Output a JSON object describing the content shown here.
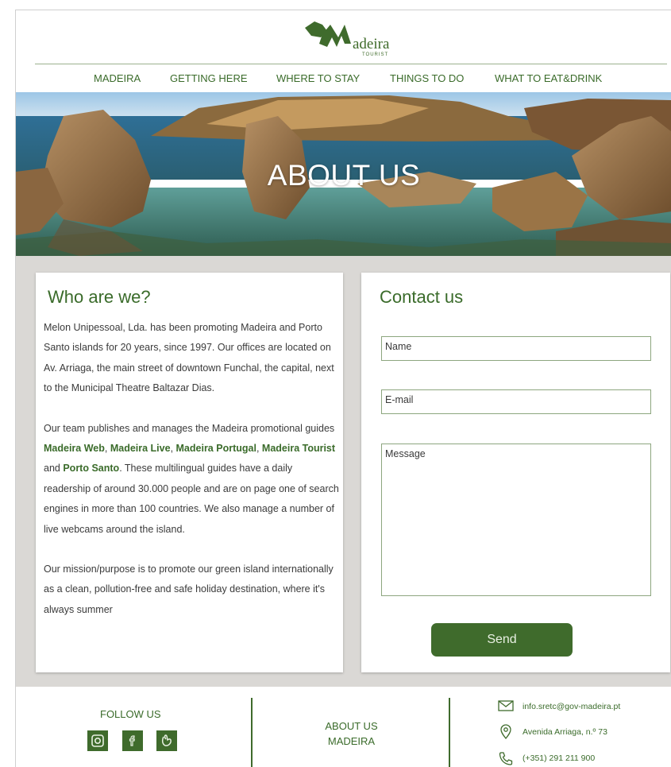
{
  "brand": {
    "name": "adeira",
    "tagline": "TOURIST",
    "green": "#3f6b2c"
  },
  "nav": {
    "items": [
      "MADEIRA",
      "GETTING HERE",
      "WHERE TO STAY",
      "THINGS TO DO",
      "WHAT TO EAT&DRINK"
    ]
  },
  "hero": {
    "title": "ABOUT US"
  },
  "about": {
    "heading": "Who are we?",
    "p1": "Melon Unipessoal, Lda. has been promoting Madeira and Porto Santo islands for 20 years, since 1997. Our offices are located on Av. Arriaga, the main street of downtown Funchal, the capital, next to the Municipal Theatre Baltazar Dias.",
    "p2_a": "Our team publishes and manages the Madeira promotional guides ",
    "guides": [
      "Madeira Web",
      "Madeira Live",
      "Madeira Portugal",
      "Madeira Tourist",
      "Porto Santo"
    ],
    "sep1": ", ",
    "sep2": ", ",
    "sep3": ",",
    "sep4": " and ",
    "p2_b": ". These multilingual guides have a daily readership of around 30.000 people and are on page one of search engines in more than 100 countries. We also manage a number of live webcams around the island.",
    "p3": "Our mission/purpose is to promote our green island internationally as a clean, pollution-free and safe holiday destination, where it's always summer"
  },
  "contact": {
    "heading": "Contact us",
    "name_placeholder": "Name",
    "email_placeholder": "E-mail",
    "message_placeholder": "Message",
    "send_label": "Send"
  },
  "footer": {
    "follow_label": "FOLLOW US",
    "social_icons": [
      "instagram-icon",
      "facebook-icon",
      "tripadvisor-icon"
    ],
    "about_line1": "ABOUT US",
    "about_line2": "MADEIRA",
    "email": "info.sretc@gov-madeira.pt",
    "address": "Avenida Arriaga, n.º 73",
    "phone": "(+351) 291 211 900"
  }
}
